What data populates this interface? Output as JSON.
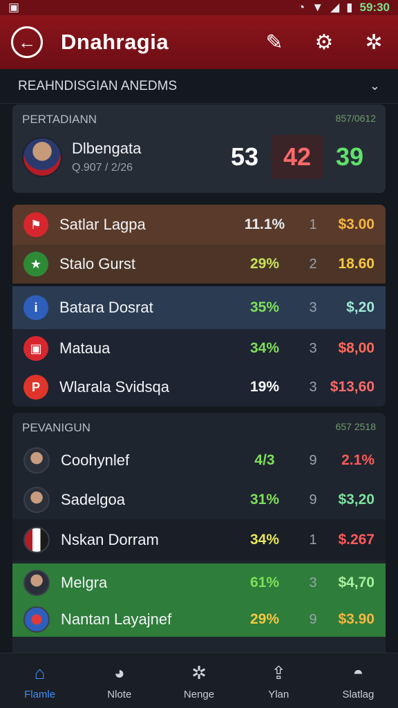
{
  "status_bar": {
    "time": "59:30"
  },
  "app_bar": {
    "title": "Dnahragia"
  },
  "section": {
    "title": "REAHNDISGIAN ANEDMS"
  },
  "featured": {
    "label": "PERTADIANN",
    "code": "857/0612",
    "player_name": "Dlbengata",
    "player_sub": "Q.907 / 2/26",
    "scores": [
      "53",
      "42",
      "39"
    ]
  },
  "group1": {
    "rows": [
      {
        "badge": "⚑",
        "badge_color": "#d7262e",
        "label": "Satlar Lagpa",
        "pct": "11.1%",
        "pct_color": "#e8ebef",
        "rank": "1",
        "price": "$3.00",
        "price_color": "#f5b642"
      },
      {
        "badge": "★",
        "badge_color": "#2f8a38",
        "label": "Stalo Gurst",
        "pct": "29%",
        "pct_color": "#c6e25a",
        "rank": "2",
        "price": "18.60",
        "price_color": "#f5c842"
      },
      {
        "badge": "i",
        "badge_color": "#2f5fbd",
        "label": "Batara Dosrat",
        "pct": "35%",
        "pct_color": "#7de05a",
        "rank": "3",
        "price": "$,20",
        "price_color": "#9fe6d6"
      },
      {
        "badge": "▣",
        "badge_color": "#d7262e",
        "label": "Mataua",
        "pct": "34%",
        "pct_color": "#7de05a",
        "rank": "3",
        "price": "$8,00",
        "price_color": "#ff6a5a"
      },
      {
        "badge": "P",
        "badge_color": "#e0352b",
        "label": "Wlarala Svidsqa",
        "pct": "19%",
        "pct_color": "#ffffff",
        "rank": "3",
        "price": "$13,60",
        "price_color": "#ff6a6a"
      }
    ]
  },
  "group2": {
    "label": "PEVANIGUN",
    "code": "657 2518",
    "rows": [
      {
        "label": "Coohynlef",
        "pct": "4/3",
        "pct_color": "#7de05a",
        "rank": "9",
        "price": "2.1%",
        "price_color": "#ff5a5a"
      },
      {
        "label": "Sadelgoa",
        "pct": "31%",
        "pct_color": "#7de05a",
        "rank": "9",
        "price": "$3,20",
        "price_color": "#7de0a0"
      },
      {
        "label": "Nskan Dorram",
        "pct": "34%",
        "pct_color": "#e6e65a",
        "rank": "1",
        "price": "$.267",
        "price_color": "#ff5a5a"
      },
      {
        "label": "Melgra",
        "pct": "61%",
        "pct_color": "#7de05a",
        "rank": "3",
        "price": "$4,70",
        "price_color": "#a8f0a0"
      },
      {
        "label": "Nantan Layajnef",
        "pct": "29%",
        "pct_color": "#f5c842",
        "rank": "9",
        "price": "$3.90",
        "price_color": "#f5b642"
      }
    ]
  },
  "bottom_nav": [
    {
      "icon": "home-icon",
      "label": "Flamle"
    },
    {
      "icon": "notification-icon",
      "label": "Nlote"
    },
    {
      "icon": "puzzle-icon",
      "label": "Nenge"
    },
    {
      "icon": "upload-icon",
      "label": "Ylan"
    },
    {
      "icon": "profile-icon",
      "label": "Slatlag"
    }
  ]
}
